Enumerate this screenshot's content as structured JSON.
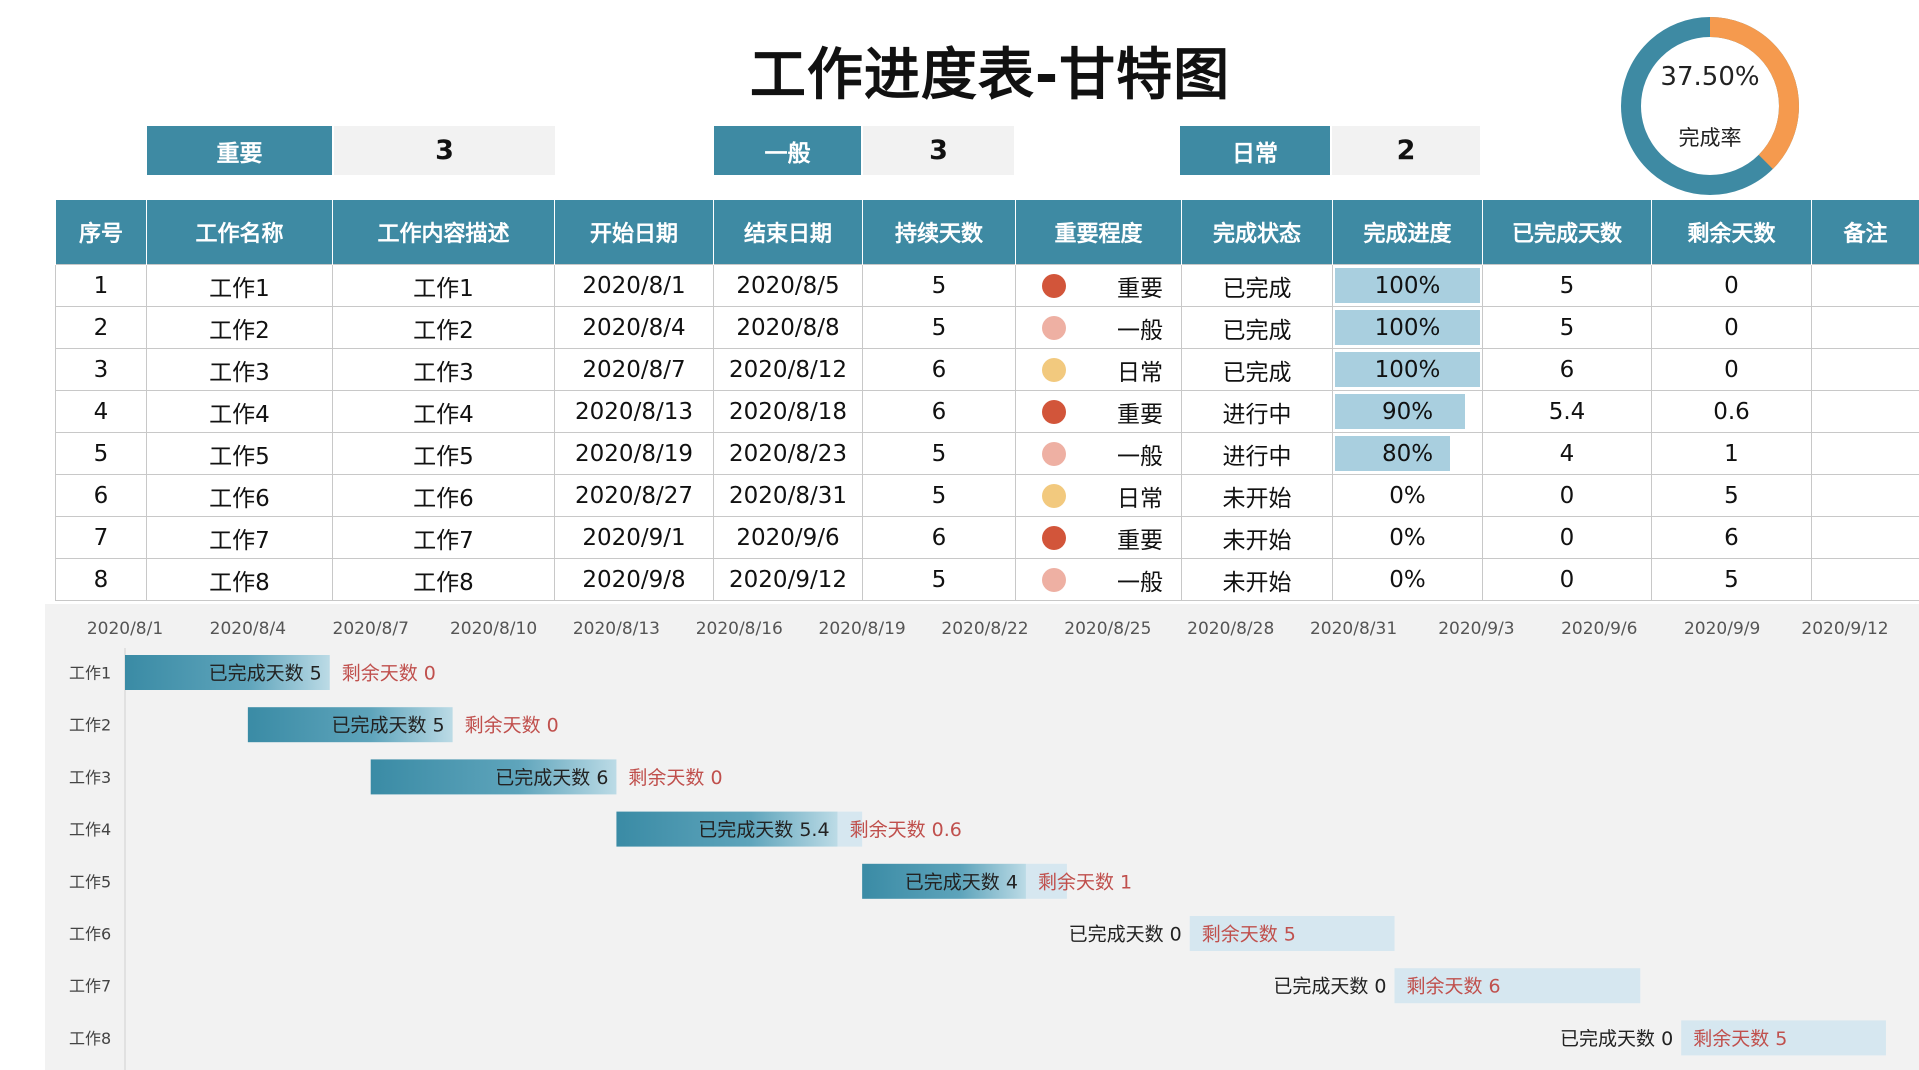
{
  "header": {
    "title": "工作进度表-甘特图"
  },
  "completion": {
    "percent": 0.375,
    "percent_text": "37.50%",
    "label": "完成率",
    "colors": {
      "done": "#f59a4e",
      "remaining": "#3e8aa3"
    }
  },
  "summary": [
    {
      "label": "重要",
      "count": "3"
    },
    {
      "label": "一般",
      "count": "3"
    },
    {
      "label": "日常",
      "count": "2"
    }
  ],
  "table": {
    "headers": [
      "序号",
      "工作名称",
      "工作内容描述",
      "开始日期",
      "结束日期",
      "持续天数",
      "重要程度",
      "完成状态",
      "完成进度",
      "已完成天数",
      "剩余天数",
      "备注"
    ],
    "rows": [
      {
        "no": "1",
        "name": "工作1",
        "desc": "工作1",
        "start": "2020/8/1",
        "end": "2020/8/5",
        "days": "5",
        "importance": "重要",
        "status": "已完成",
        "progress": "100%",
        "progress_value": 1.0,
        "done": "5",
        "remain": "0",
        "note": ""
      },
      {
        "no": "2",
        "name": "工作2",
        "desc": "工作2",
        "start": "2020/8/4",
        "end": "2020/8/8",
        "days": "5",
        "importance": "一般",
        "status": "已完成",
        "progress": "100%",
        "progress_value": 1.0,
        "done": "5",
        "remain": "0",
        "note": ""
      },
      {
        "no": "3",
        "name": "工作3",
        "desc": "工作3",
        "start": "2020/8/7",
        "end": "2020/8/12",
        "days": "6",
        "importance": "日常",
        "status": "已完成",
        "progress": "100%",
        "progress_value": 1.0,
        "done": "6",
        "remain": "0",
        "note": ""
      },
      {
        "no": "4",
        "name": "工作4",
        "desc": "工作4",
        "start": "2020/8/13",
        "end": "2020/8/18",
        "days": "6",
        "importance": "重要",
        "status": "进行中",
        "progress": "90%",
        "progress_value": 0.9,
        "done": "5.4",
        "remain": "0.6",
        "note": ""
      },
      {
        "no": "5",
        "name": "工作5",
        "desc": "工作5",
        "start": "2020/8/19",
        "end": "2020/8/23",
        "days": "5",
        "importance": "一般",
        "status": "进行中",
        "progress": "80%",
        "progress_value": 0.8,
        "done": "4",
        "remain": "1",
        "note": ""
      },
      {
        "no": "6",
        "name": "工作6",
        "desc": "工作6",
        "start": "2020/8/27",
        "end": "2020/8/31",
        "days": "5",
        "importance": "日常",
        "status": "未开始",
        "progress": "0%",
        "progress_value": 0,
        "done": "0",
        "remain": "5",
        "note": ""
      },
      {
        "no": "7",
        "name": "工作7",
        "desc": "工作7",
        "start": "2020/9/1",
        "end": "2020/9/6",
        "days": "6",
        "importance": "重要",
        "status": "未开始",
        "progress": "0%",
        "progress_value": 0,
        "done": "0",
        "remain": "6",
        "note": ""
      },
      {
        "no": "8",
        "name": "工作8",
        "desc": "工作8",
        "start": "2020/9/8",
        "end": "2020/9/12",
        "days": "5",
        "importance": "一般",
        "status": "未开始",
        "progress": "0%",
        "progress_value": 0,
        "done": "0",
        "remain": "5",
        "note": ""
      }
    ],
    "importance_colors": {
      "重要": "#d2553a",
      "一般": "#eeb0a3",
      "日常": "#f2c97e"
    }
  },
  "chart_data": {
    "type": "bar",
    "orientation": "horizontal-stacked",
    "categories": [
      "工作1",
      "工作2",
      "工作3",
      "工作4",
      "工作5",
      "工作6",
      "工作7",
      "工作8"
    ],
    "start": [
      "2020/8/1",
      "2020/8/4",
      "2020/8/7",
      "2020/8/13",
      "2020/8/19",
      "2020/8/27",
      "2020/9/1",
      "2020/9/8"
    ],
    "series": [
      {
        "name": "已完成天数",
        "values": [
          5,
          5,
          6,
          5.4,
          4,
          0,
          0,
          0
        ],
        "color": "#3e8aa3"
      },
      {
        "name": "剩余天数",
        "values": [
          0,
          0,
          0,
          0.6,
          1,
          5,
          6,
          5
        ],
        "color": "#d6e7f0"
      }
    ],
    "xticks": [
      "2020/8/1",
      "2020/8/4",
      "2020/8/7",
      "2020/8/10",
      "2020/8/13",
      "2020/8/16",
      "2020/8/19",
      "2020/8/22",
      "2020/8/25",
      "2020/8/28",
      "2020/8/31",
      "2020/9/3",
      "2020/9/6",
      "2020/9/9",
      "2020/9/12"
    ],
    "xlim": [
      "2020/8/1",
      "2020/9/12"
    ],
    "grid": false,
    "label_colors": {
      "done": "#222222",
      "remain": "#c0504d"
    }
  }
}
